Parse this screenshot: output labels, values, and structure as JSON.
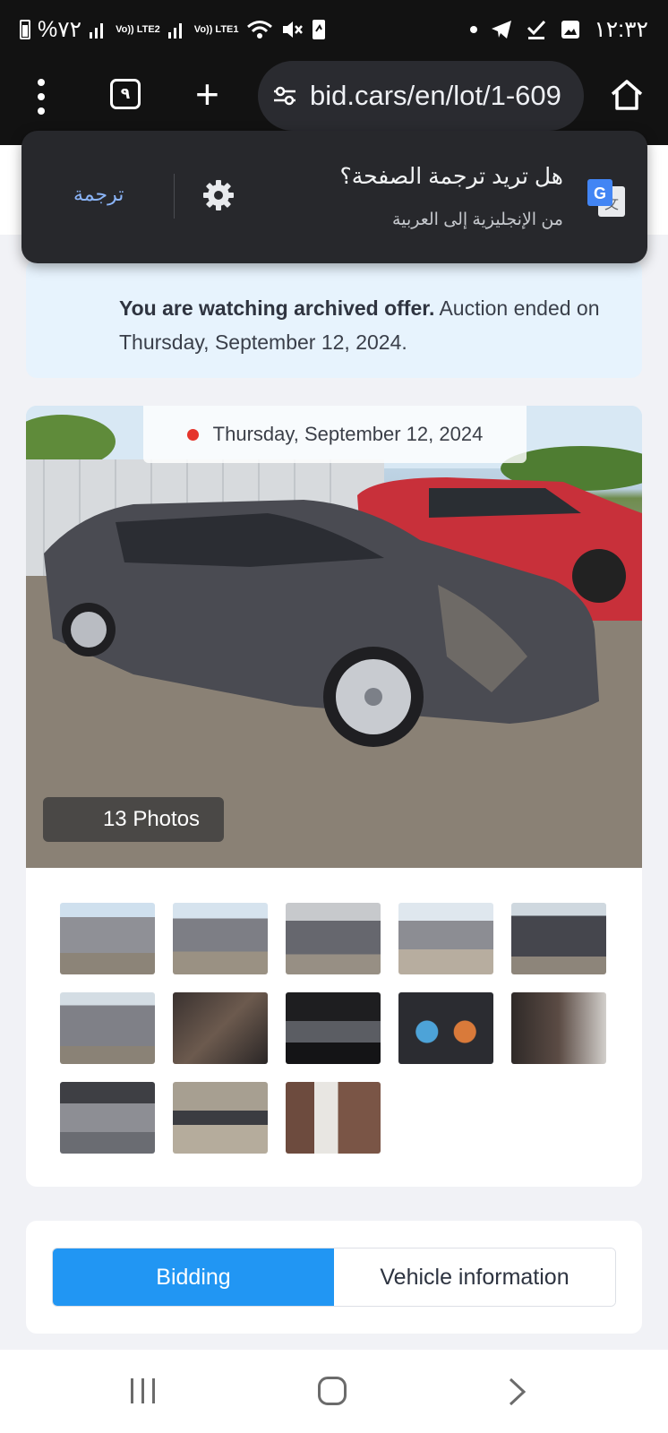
{
  "status_bar": {
    "battery_text": "%٧٢",
    "sim1_label": "Vo)) LTE2",
    "sim2_label": "Vo)) LTE1",
    "time": "١٢:٣٢"
  },
  "browser": {
    "tab_count": "٩",
    "url": "bid.cars/en/lot/1-609",
    "icons": [
      "menu-icon",
      "tabs-icon",
      "new-tab-icon",
      "site-settings-icon",
      "home-icon"
    ]
  },
  "translate_prompt": {
    "title": "هل تريد ترجمة الصفحة؟",
    "subtitle": "من الإنجليزية إلى العربية",
    "action_label": "ترجمة"
  },
  "notice": {
    "bold_text": "You are watching archived offer.",
    "text": " Auction ended on Thursday, September 12, 2024."
  },
  "gallery": {
    "date_label": "Thursday, September 12, 2024",
    "photos_label": "13 Photos",
    "thumbnail_count": 13
  },
  "tabs": {
    "bidding_label": "Bidding",
    "vehicle_info_label": "Vehicle information",
    "active": "Bidding"
  },
  "colors": {
    "accent": "#2196f3",
    "notice_bg": "#e7f3fd",
    "translate_link": "#8ab4f8",
    "live_dot": "#e5342b"
  }
}
